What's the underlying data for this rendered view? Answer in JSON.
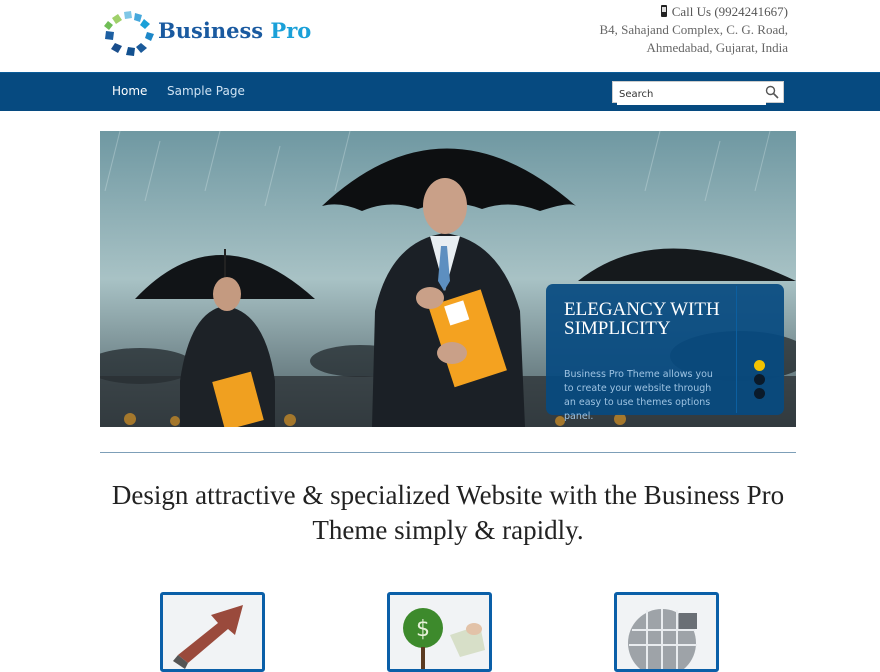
{
  "brand": {
    "name_part1": "Business",
    "name_part2": "Pro"
  },
  "contact": {
    "call": "Call Us (9924241667)",
    "address_line1": "B4, Sahajand Complex, C. G. Road,",
    "address_line2": "Ahmedabad, Gujarat, India"
  },
  "nav": {
    "items": [
      {
        "label": "Home"
      },
      {
        "label": "Sample Page"
      }
    ]
  },
  "search": {
    "placeholder": "Search",
    "value": "Search"
  },
  "slider": {
    "caption_title": "Elegancy with simplicity",
    "caption_text": "Business Pro Theme allows you to create your website through an easy to use themes options panel.",
    "active_slide": 1,
    "slide_count": 3,
    "accent_color": "#f2c200"
  },
  "tagline": "Design attractive & specialized Website with the Business Pro Theme simply & rapidly.",
  "features": [
    {
      "icon": "growth-arrow-icon"
    },
    {
      "icon": "money-tree-icon"
    },
    {
      "icon": "globe-icon"
    }
  ],
  "colors": {
    "nav_bg": "#064a80",
    "brand_blue": "#1a5aa0",
    "brand_cyan": "#1aa0d8",
    "feature_border": "#0a5fa8"
  }
}
